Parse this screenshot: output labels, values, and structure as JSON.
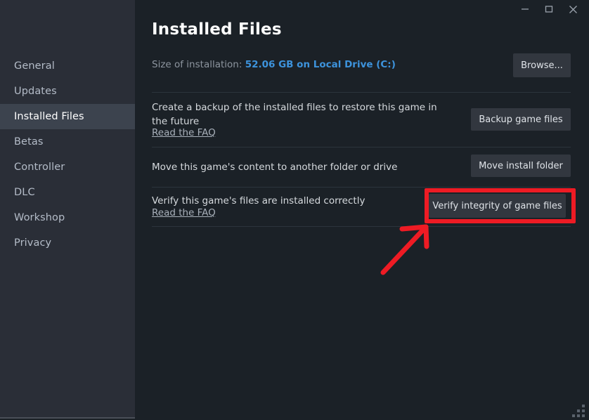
{
  "window": {
    "controls": [
      {
        "name": "minimize",
        "glyph": "minimize-icon"
      },
      {
        "name": "maximize",
        "glyph": "maximize-icon"
      },
      {
        "name": "close",
        "glyph": "close-icon"
      }
    ]
  },
  "sidebar": {
    "items": [
      {
        "label": "General",
        "active": false
      },
      {
        "label": "Updates",
        "active": false
      },
      {
        "label": "Installed Files",
        "active": true
      },
      {
        "label": "Betas",
        "active": false
      },
      {
        "label": "Controller",
        "active": false
      },
      {
        "label": "DLC",
        "active": false
      },
      {
        "label": "Workshop",
        "active": false
      },
      {
        "label": "Privacy",
        "active": false
      }
    ]
  },
  "main": {
    "title": "Installed Files",
    "size_row": {
      "label": "Size of installation:",
      "value": "52.06 GB on Local Drive (C:)",
      "browse_label": "Browse..."
    },
    "rows": [
      {
        "text": "Create a backup of the installed files to restore this game in the future",
        "link": "Read the FAQ",
        "button": "Backup game files"
      },
      {
        "text": "Move this game's content to another folder or drive",
        "link": "",
        "button": "Move install folder"
      },
      {
        "text": "Verify this game's files are installed correctly",
        "link": "Read the FAQ",
        "button": "Verify integrity of game files"
      }
    ]
  },
  "annotation": {
    "highlight_color": "#ee1b24",
    "highlight_target": "Verify integrity of game files"
  },
  "colors": {
    "sidebar_bg": "#2a2e37",
    "sidebar_active_bg": "#3c434e",
    "panel_bg": "#1b2127",
    "button_bg": "#32373f",
    "accent_blue": "#3d93dc",
    "annotation_red": "#ee1b24",
    "text_primary": "#d6dade",
    "text_muted": "#8d959f"
  }
}
